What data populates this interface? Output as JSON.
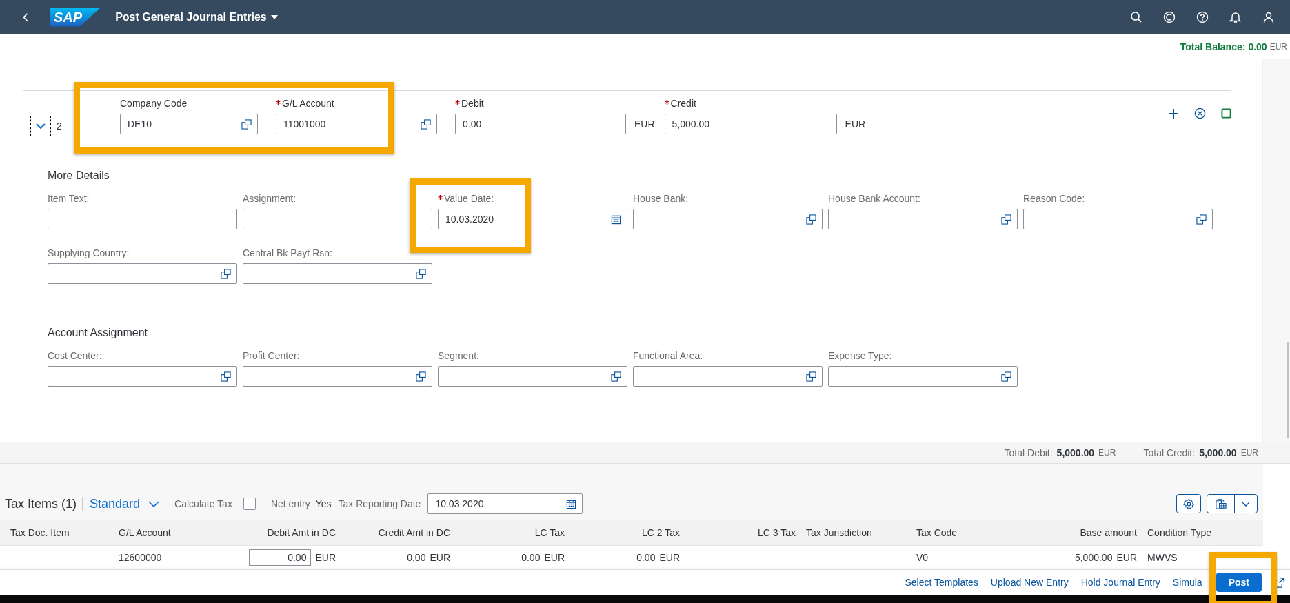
{
  "shell": {
    "logo": "SAP",
    "title": "Post General Journal Entries"
  },
  "balance": {
    "label": "Total Balance:",
    "value": "0.00",
    "currency": "EUR"
  },
  "line_item": {
    "number": "2",
    "expanded": true,
    "fields": [
      {
        "label": "Company Code",
        "required": false,
        "value": "DE10",
        "kind": "valuehelp"
      },
      {
        "label": "G/L Account",
        "required": true,
        "value": "11001000",
        "kind": "valuehelp"
      },
      {
        "label": "Debit",
        "required": true,
        "value": "0.00",
        "kind": "amount",
        "currency": "EUR"
      },
      {
        "label": "Credit",
        "required": true,
        "value": "5,000.00",
        "kind": "amount",
        "currency": "EUR"
      }
    ]
  },
  "more_details": {
    "title": "More Details",
    "fields": [
      {
        "label": "Item Text:",
        "required": false,
        "kind": "text"
      },
      {
        "label": "Assignment:",
        "required": false,
        "kind": "text"
      },
      {
        "label": "Value Date:",
        "required": true,
        "value": "10.03.2020",
        "kind": "date"
      },
      {
        "label": "House Bank:",
        "required": false,
        "kind": "valuehelp"
      },
      {
        "label": "House Bank Account:",
        "required": false,
        "kind": "valuehelp"
      },
      {
        "label": "Reason Code:",
        "required": false,
        "kind": "valuehelp"
      },
      {
        "label": "Supplying Country:",
        "required": false,
        "kind": "valuehelp"
      },
      {
        "label": "Central Bk Payt Rsn:",
        "required": false,
        "kind": "valuehelp"
      }
    ]
  },
  "account_assignment": {
    "title": "Account Assignment",
    "fields": [
      {
        "label": "Cost Center:",
        "required": false,
        "kind": "valuehelp"
      },
      {
        "label": "Profit Center:",
        "required": false,
        "kind": "valuehelp"
      },
      {
        "label": "Segment:",
        "required": false,
        "kind": "valuehelp"
      },
      {
        "label": "Functional Area:",
        "required": false,
        "kind": "valuehelp"
      },
      {
        "label": "Expense Type:",
        "required": false,
        "kind": "valuehelp"
      }
    ]
  },
  "totals": [
    {
      "label": "Total Debit:",
      "value": "5,000.00",
      "currency": "EUR"
    },
    {
      "label": "Total Credit:",
      "value": "5,000.00",
      "currency": "EUR"
    }
  ],
  "tax_items": {
    "title": "Tax Items (1)",
    "variant": "Standard",
    "calculate_tax": {
      "label": "Calculate Tax",
      "checked": false
    },
    "net_entry": {
      "label": "Net entry",
      "value": "Yes"
    },
    "reporting_date": {
      "label": "Tax Reporting Date",
      "value": "10.03.2020"
    },
    "columns": [
      {
        "label": "Tax Doc. Item",
        "kind": "text"
      },
      {
        "label": "G/L Account",
        "kind": "text"
      },
      {
        "label": "Debit Amt in DC",
        "kind": "amount"
      },
      {
        "label": "Credit Amt in DC",
        "kind": "amount"
      },
      {
        "label": "LC Tax",
        "kind": "amount"
      },
      {
        "label": "LC 2 Tax",
        "kind": "amount"
      },
      {
        "label": "LC 3 Tax",
        "kind": "amount"
      },
      {
        "label": "Tax Jurisdiction",
        "kind": "text"
      },
      {
        "label": "Tax Code",
        "kind": "text"
      },
      {
        "label": "Base amount",
        "kind": "amount"
      },
      {
        "label": "Condition Type",
        "kind": "text"
      }
    ],
    "rows": [
      {
        "cells": [
          {
            "kind": "text"
          },
          {
            "kind": "text",
            "value": "12600000"
          },
          {
            "kind": "input",
            "value": "0.00",
            "currency": "EUR"
          },
          {
            "kind": "amount",
            "value": "0.00",
            "currency": "EUR"
          },
          {
            "kind": "amount",
            "value": "0.00",
            "currency": "EUR"
          },
          {
            "kind": "amount",
            "value": "0.00",
            "currency": "EUR"
          },
          {
            "kind": "amount"
          },
          {
            "kind": "text"
          },
          {
            "kind": "text",
            "value": "V0"
          },
          {
            "kind": "amount",
            "value": "5,000.00",
            "currency": "EUR"
          },
          {
            "kind": "text",
            "value": "MWVS"
          }
        ]
      }
    ]
  },
  "footer": {
    "actions": [
      "Select Templates",
      "Upload New Entry",
      "Hold Journal Entry",
      "Simula"
    ],
    "primary": "Post"
  }
}
